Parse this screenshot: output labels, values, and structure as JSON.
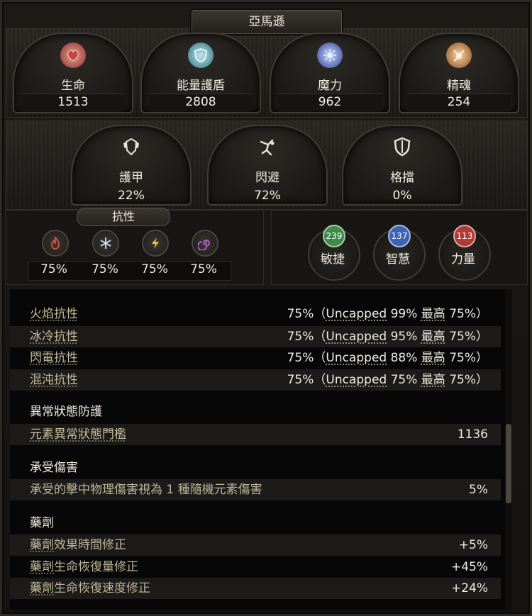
{
  "window": {
    "title": "亞馬遜"
  },
  "primary_stats": [
    {
      "label": "生命",
      "value": "1513",
      "icon": "heart-icon",
      "color": "#c7453f"
    },
    {
      "label": "能量護盾",
      "value": "2808",
      "icon": "shield-icon",
      "color": "#5fb6c2"
    },
    {
      "label": "魔力",
      "value": "962",
      "icon": "mana-icon",
      "color": "#4b74d6"
    },
    {
      "label": "精魂",
      "value": "254",
      "icon": "spirit-icon",
      "color": "#e08a3c"
    }
  ],
  "defence_stats": [
    {
      "label": "護甲",
      "value": "22%",
      "icon": "armour-icon"
    },
    {
      "label": "閃避",
      "value": "72%",
      "icon": "evasion-icon"
    },
    {
      "label": "格擋",
      "value": "0%",
      "icon": "block-icon"
    }
  ],
  "resistances": {
    "title": "抗性",
    "items": [
      {
        "name": "fire",
        "icon": "fire-icon",
        "value": "75%",
        "color": "#e0533a"
      },
      {
        "name": "cold",
        "icon": "snowflake-icon",
        "value": "75%",
        "color": "#9fc7e4"
      },
      {
        "name": "lightning",
        "icon": "lightning-icon",
        "value": "75%",
        "color": "#e6c64a"
      },
      {
        "name": "chaos",
        "icon": "chaos-icon",
        "value": "75%",
        "color": "#b06ad1"
      }
    ]
  },
  "attributes": [
    {
      "label": "敏捷",
      "value": "239",
      "color": "#3e8a4a"
    },
    {
      "label": "智慧",
      "value": "137",
      "color": "#3f63b4"
    },
    {
      "label": "力量",
      "value": "113",
      "color": "#b03a35"
    }
  ],
  "detail_list": {
    "resistance_rows": [
      {
        "label": "火焰抗性",
        "value": "75%",
        "paren_open": "（",
        "uncapped": "Uncapped",
        "uncapped_val": " 99% ",
        "max": "最高",
        "max_val": " 75%）"
      },
      {
        "label": "冰冷抗性",
        "value": "75%",
        "paren_open": "（",
        "uncapped": "Uncapped",
        "uncapped_val": " 95% ",
        "max": "最高",
        "max_val": " 75%）"
      },
      {
        "label": "閃電抗性",
        "value": "75%",
        "paren_open": "（",
        "uncapped": "Uncapped",
        "uncapped_val": " 88% ",
        "max": "最高",
        "max_val": " 75%）"
      },
      {
        "label": "混沌抗性",
        "value": "75%",
        "paren_open": "（",
        "uncapped": "Uncapped",
        "uncapped_val": " 75% ",
        "max": "最高",
        "max_val": " 75%）"
      }
    ],
    "section_ailment": "異常狀態防護",
    "ailment_row": {
      "label": "元素異常狀態門檻",
      "value": "1136"
    },
    "section_damage_taken": "承受傷害",
    "damage_row": {
      "label": "承受的擊中物理傷害視為 1 種隨機元素傷害",
      "value": "5%"
    },
    "section_flask": "藥劑",
    "flask_rows": [
      {
        "label_u": "藥劑",
        "label_rest": "效果時間修正",
        "value": "+5%"
      },
      {
        "label_u": "藥劑",
        "label_rest": "生命恢復量修正",
        "value": "+45%"
      },
      {
        "label_u": "藥劑",
        "label_rest": "生命恢復速度修正",
        "value": "+24%"
      }
    ]
  }
}
